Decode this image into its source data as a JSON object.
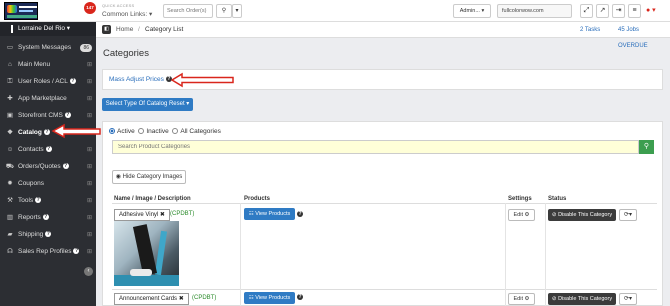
{
  "topbar": {
    "notification_count": "147",
    "quick_access_label": "QUICK ACCESS",
    "common_links_label": "Common Links: ▾",
    "search_orders_placeholder": "Search Order(s)",
    "admin_label": "Admin... ▾",
    "url_value": "fullcolorwow.com"
  },
  "sidebar": {
    "user_name": "Lorraine Del Rio ▾",
    "items": [
      {
        "label": "System Messages",
        "icon": "chat-icon",
        "badge": "86"
      },
      {
        "label": "Main Menu",
        "icon": "home-icon"
      },
      {
        "label": "User Roles / ACL",
        "icon": "key-icon"
      },
      {
        "label": "App Marketplace",
        "icon": "puzzle-icon"
      },
      {
        "label": "Storefront CMS",
        "icon": "monitor-icon"
      },
      {
        "label": "Catalog",
        "icon": "cubes-icon"
      },
      {
        "label": "Contacts",
        "icon": "users-icon"
      },
      {
        "label": "Orders/Quotes",
        "icon": "cart-icon"
      },
      {
        "label": "Coupons",
        "icon": "gear-icon"
      },
      {
        "label": "Tools",
        "icon": "wrench-icon"
      },
      {
        "label": "Reports",
        "icon": "chart-icon"
      },
      {
        "label": "Shipping",
        "icon": "truck-icon"
      },
      {
        "label": "Sales Rep Profiles",
        "icon": "headset-icon"
      }
    ]
  },
  "breadcrumb": {
    "home": "Home",
    "separator": "/",
    "current": "Category List",
    "right1": "2 Tasks",
    "right2": "45 Jobs OVERDUE"
  },
  "page": {
    "title": "Categories",
    "mass_adjust_label": "Mass Adjust Prices",
    "catalog_type_button": "Select Type Of Catalog Reset ▾",
    "radio_active": "Active",
    "radio_inactive": "Inactive",
    "radio_all": "All Categories",
    "search_placeholder": "Search Product Categories",
    "hide_images_button": "Hide Category Images"
  },
  "table": {
    "headers": [
      "Name / Image / Description",
      "Products",
      "Settings",
      "Status"
    ],
    "rows": [
      {
        "name": "Adhesive Vinyl",
        "code": "(CPDBT)",
        "products_button": "View Products",
        "edit_button": "Edit",
        "status_button": "Disable This Category"
      },
      {
        "name": "Announcement Cards",
        "code": "(CPDBT)",
        "products_button": "View Products",
        "edit_button": "Edit",
        "status_button": "Disable This Category"
      }
    ]
  },
  "colors": {
    "sidebar_bg": "#2c2e33",
    "primary_blue": "#2f7bc4",
    "search_green": "#3c9e4f",
    "annotation_red": "#d9261c"
  }
}
